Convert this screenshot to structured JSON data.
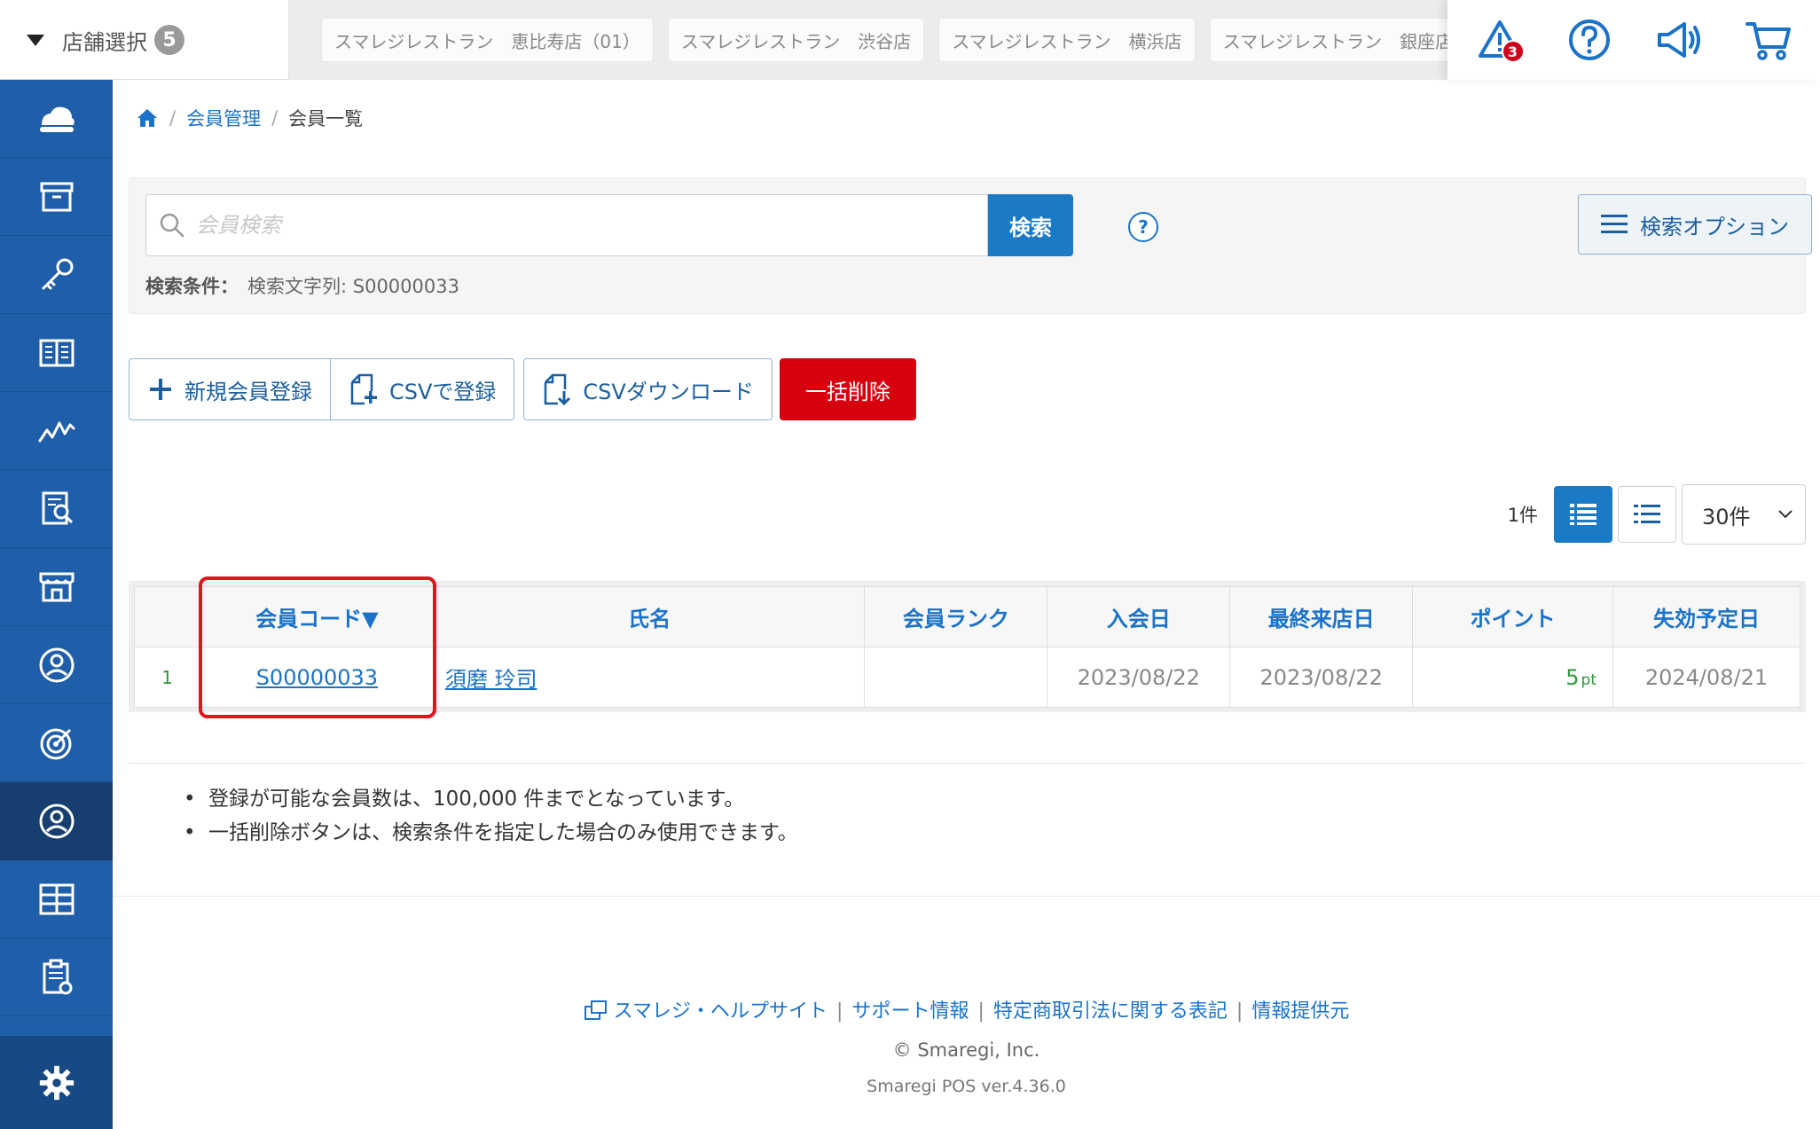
{
  "header": {
    "store_select_label": "店舗選択",
    "store_count": "5",
    "stores": [
      "スマレジレストラン　恵比寿店（01）",
      "スマレジレストラン　渋谷店",
      "スマレジレストラン　横浜店",
      "スマレジレストラン　銀座店（B"
    ],
    "alert_count": "3",
    "icons": [
      "alert-icon",
      "help-icon",
      "megaphone-icon",
      "cart-icon"
    ]
  },
  "sidebar": {
    "items": [
      "dashboard-icon",
      "archive-icon",
      "key-icon",
      "book-icon",
      "analytics-icon",
      "report-search-icon",
      "store-icon",
      "staff-icon",
      "target-icon",
      "member-icon",
      "grid-icon",
      "clipboard-icon"
    ],
    "active_index": 9,
    "bottom": "gear-icon"
  },
  "breadcrumb": {
    "items": [
      "会員管理",
      "会員一覧"
    ]
  },
  "search": {
    "placeholder": "会員検索",
    "value": "",
    "button_label": "検索",
    "help": "?",
    "condition_label": "検索条件：",
    "condition_value": "検索文字列: S00000033",
    "options_label": "検索オプション"
  },
  "actions": {
    "new_member": "新規会員登録",
    "csv_register": "CSVで登録",
    "csv_download": "CSVダウンロード",
    "bulk_delete": "一括削除"
  },
  "list": {
    "count": "1件",
    "per_page": "30件"
  },
  "table": {
    "headers": [
      "会員コード▼",
      "氏名",
      "会員ランク",
      "入会日",
      "最終来店日",
      "ポイント",
      "失効予定日"
    ],
    "rows": [
      {
        "num": "1",
        "code": "S00000033",
        "name": "須磨 玲司",
        "rank": "",
        "joined": "2023/08/22",
        "last_visit": "2023/08/22",
        "points": "5",
        "points_unit": "pt",
        "expiry": "2024/08/21"
      }
    ]
  },
  "notes": [
    "登録が可能な会員数は、100,000 件までとなっています。",
    "一括削除ボタンは、検索条件を指定した場合のみ使用できます。"
  ],
  "footer": {
    "links": [
      "スマレジ・ヘルプサイト",
      "サポート情報",
      "特定商取引法に関する表記",
      "情報提供元"
    ],
    "copyright": "© Smaregi, Inc.",
    "version": "Smaregi POS ver.4.36.0"
  },
  "colors": {
    "sidebar": "#1f5ea8",
    "primary": "#1b7ac5",
    "danger": "#d7000f",
    "highlight": "#e0141e"
  }
}
